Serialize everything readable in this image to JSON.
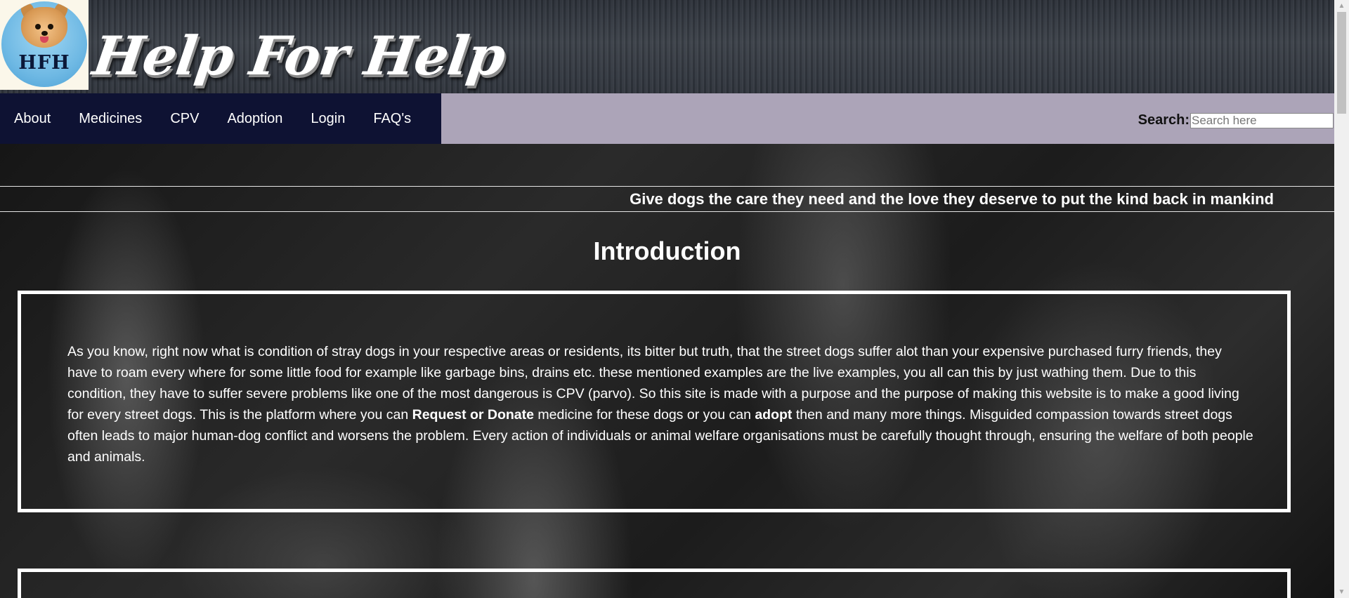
{
  "header": {
    "logo_text": "HFH",
    "site_title": "Help For Help"
  },
  "nav": {
    "items": [
      {
        "label": "About"
      },
      {
        "label": "Medicines"
      },
      {
        "label": "CPV"
      },
      {
        "label": "Adoption"
      },
      {
        "label": "Login"
      },
      {
        "label": "FAQ's"
      }
    ],
    "search_label": "Search:",
    "search_placeholder": "Search here",
    "search_value": ""
  },
  "tagline": "Give dogs the care they need and the love they deserve to put the kind back in mankind",
  "intro": {
    "title": "Introduction",
    "text_part1": "As you know, right now what is condition of stray dogs in your respective areas or residents, its bitter but truth, that the street dogs suffer alot than your expensive purchased furry friends, they have to roam every where for some little food for example like garbage bins, drains etc. these mentioned examples are the live examples, you all can this by just wathing them. Due to this condition, they have to suffer severe problems like one of the most dangerous is CPV (parvo). So this site is made with a purpose and the purpose of making this website is to make a good living for every street dogs. This is the platform where you can ",
    "text_bold1": "Request or Donate",
    "text_part2": " medicine for these dogs or you can ",
    "text_bold2": "adopt",
    "text_part3": " then and many more things. Misguided compassion towards street dogs often leads to major human-dog conflict and worsens the problem. Every action of individuals or animal welfare organisations must be carefully thought through, ensuring the welfare of both people and animals."
  },
  "colors": {
    "nav_dark": "#0e1233",
    "nav_light": "#aca4b8",
    "text_light": "#ffffff"
  },
  "icons": {
    "scroll_up": "triangle-up",
    "scroll_down": "triangle-down"
  }
}
